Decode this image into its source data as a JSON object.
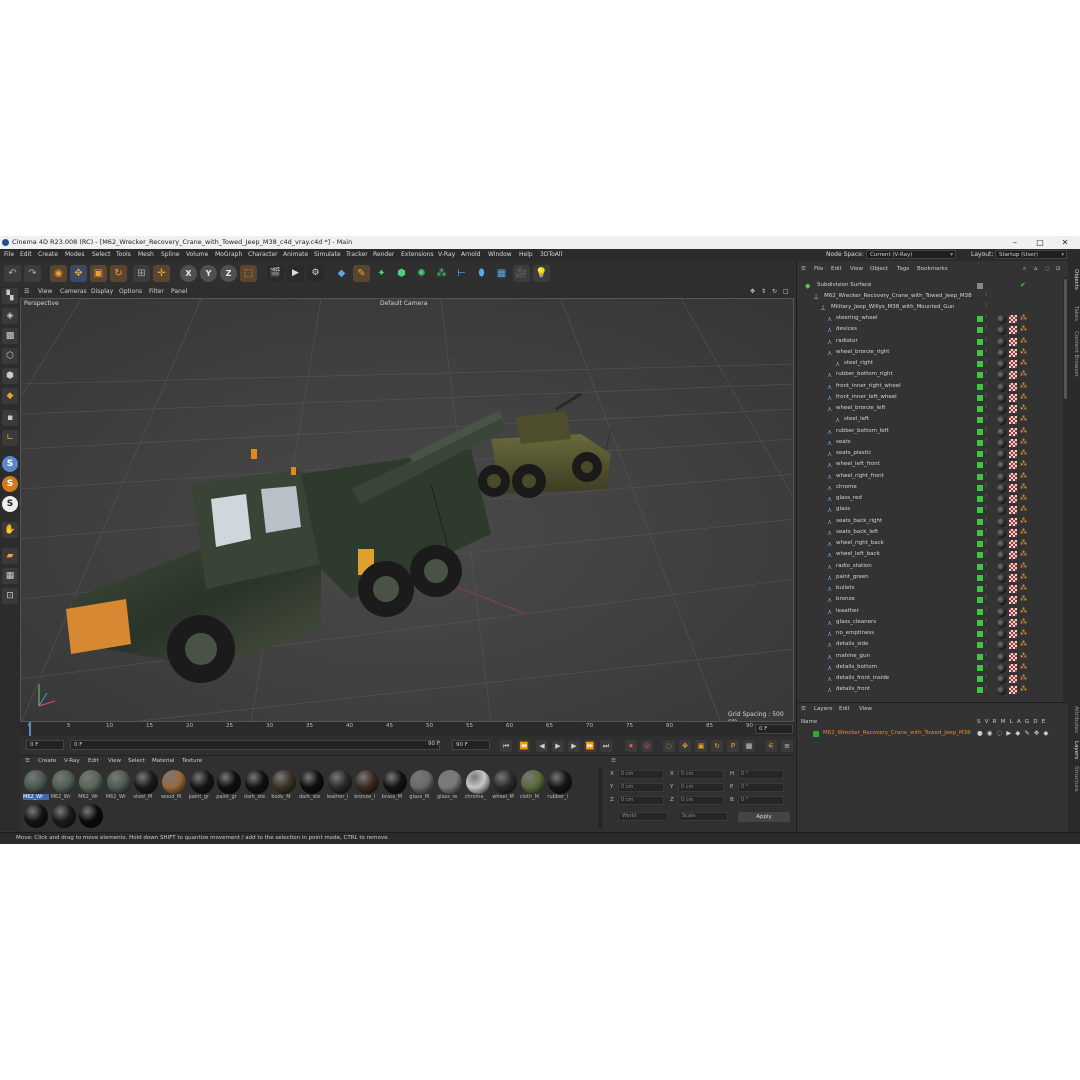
{
  "window": {
    "title": "Cinema 4D R23.008 (RC) - [M62_Wrecker_Recovery_Crane_with_Towed_Jeep_M38_c4d_vray.c4d *] - Main",
    "minimize": "–",
    "maximize": "□",
    "close": "✕"
  },
  "menubar": {
    "items": [
      "File",
      "Edit",
      "Create",
      "Modes",
      "Select",
      "Tools",
      "Mesh",
      "Spline",
      "Volume",
      "MoGraph",
      "Character",
      "Animate",
      "Simulate",
      "Tracker",
      "Render",
      "Extensions",
      "V-Ray",
      "Arnold",
      "Window",
      "Help",
      "3DToAll"
    ],
    "node_space_label": "Node Space:",
    "node_space_value": "Current (V-Ray)",
    "layout_label": "Layout:",
    "layout_value": "Startup (User)"
  },
  "viewport": {
    "menu": [
      "View",
      "Cameras",
      "Display",
      "Options",
      "Filter",
      "Panel"
    ],
    "name": "Perspective",
    "camera": "Default Camera",
    "grid_spacing": "Grid Spacing : 500 cm"
  },
  "timeline": {
    "ticks": [
      "0",
      "5",
      "10",
      "15",
      "20",
      "25",
      "30",
      "35",
      "40",
      "45",
      "50",
      "55",
      "60",
      "65",
      "70",
      "75",
      "80",
      "85",
      "90"
    ],
    "current_frame": "0 F",
    "start_frame": "0 F",
    "preview_start": "0 F",
    "preview_end": "90 F",
    "end_frame": "90 F",
    "frame_display": "0 F"
  },
  "material_manager": {
    "menu": [
      "Create",
      "V-Ray",
      "Edit",
      "View",
      "Select",
      "Material",
      "Texture"
    ],
    "materials": [
      {
        "name": "M62_Wr",
        "color": "#4a5a4f"
      },
      {
        "name": "M62_Wr",
        "color": "#505e52"
      },
      {
        "name": "M62_Wr",
        "color": "#59665a"
      },
      {
        "name": "M62_Wr",
        "color": "#4d5b50"
      },
      {
        "name": "steel_M",
        "color": "#1a1a1a"
      },
      {
        "name": "wood_M",
        "color": "#9a6a3a"
      },
      {
        "name": "paint_gr",
        "color": "#151515"
      },
      {
        "name": "paint_gr",
        "color": "#0e0e0e"
      },
      {
        "name": "dark_ste",
        "color": "#111111"
      },
      {
        "name": "body_M",
        "color": "#3a3424"
      },
      {
        "name": "dark_ste",
        "color": "#0d0d0d"
      },
      {
        "name": "leather_l",
        "color": "#2a2a2a"
      },
      {
        "name": "bronze_l",
        "color": "#3a2a20"
      },
      {
        "name": "brass_M",
        "color": "#121212"
      },
      {
        "name": "glass_M",
        "color": "#6a6a6a"
      },
      {
        "name": "glass_re",
        "color": "#7a7a7a"
      },
      {
        "name": "chrome_",
        "color": "#c8c8c8"
      },
      {
        "name": "wheel_M",
        "color": "#2a2a2a"
      },
      {
        "name": "cloth_M",
        "color": "#5a6a3a"
      },
      {
        "name": "rubber_l",
        "color": "#151515"
      },
      {
        "name": "",
        "color": "#121212"
      },
      {
        "name": "",
        "color": "#1a1a1a"
      },
      {
        "name": "",
        "color": "#0a0a0a"
      }
    ]
  },
  "coordinates": {
    "rows": [
      {
        "a": "X",
        "av": "0 cm",
        "b": "X",
        "bv": "0 cm",
        "c": "H",
        "cv": "0 °"
      },
      {
        "a": "Y",
        "av": "0 cm",
        "b": "Y",
        "bv": "0 cm",
        "c": "P",
        "cv": "0 °"
      },
      {
        "a": "Z",
        "av": "0 cm",
        "b": "Z",
        "bv": "0 cm",
        "c": "B",
        "cv": "0 °"
      }
    ],
    "mode": "World",
    "mode2": "Scale",
    "apply": "Apply"
  },
  "status": "Move: Click and drag to move elements. Hold down SHIFT to quantize movement / add to the selection in point mode, CTRL to remove.",
  "object_manager": {
    "menu": [
      "File",
      "Edit",
      "View",
      "Object",
      "Tags",
      "Bookmarks"
    ],
    "root": "Subdivision Surface",
    "group": "M62_Wrecker_Recovery_Crane_with_Towed_Jeep_M38",
    "subgroup": "Military_Jeep_Willys_M38_with_Mounted_Gun",
    "objects": [
      {
        "name": "steering_wheel",
        "indent": 0
      },
      {
        "name": "devices",
        "indent": 0
      },
      {
        "name": "radiator",
        "indent": 0
      },
      {
        "name": "wheel_bronze_right",
        "indent": 0
      },
      {
        "name": "steel_right",
        "indent": 1
      },
      {
        "name": "rubber_bottom_right",
        "indent": 0
      },
      {
        "name": "front_inner_right_wheel",
        "indent": 0
      },
      {
        "name": "front_inner_left_wheel",
        "indent": 0
      },
      {
        "name": "wheel_bronze_left",
        "indent": 0
      },
      {
        "name": "steel_left",
        "indent": 1
      },
      {
        "name": "rubber_bottom_left",
        "indent": 0
      },
      {
        "name": "seats",
        "indent": 0
      },
      {
        "name": "seats_plastic",
        "indent": 0
      },
      {
        "name": "wheel_left_front",
        "indent": 0
      },
      {
        "name": "wheel_right_front",
        "indent": 0
      },
      {
        "name": "chrome",
        "indent": 0
      },
      {
        "name": "glass_red",
        "indent": 0
      },
      {
        "name": "glass",
        "indent": 0
      },
      {
        "name": "seats_back_right",
        "indent": 0
      },
      {
        "name": "seats_back_left",
        "indent": 0
      },
      {
        "name": "wheel_right_back",
        "indent": 0
      },
      {
        "name": "wheel_left_back",
        "indent": 0
      },
      {
        "name": "radio_station",
        "indent": 0
      },
      {
        "name": "paint_green",
        "indent": 0
      },
      {
        "name": "bullets",
        "indent": 0
      },
      {
        "name": "bronze",
        "indent": 0
      },
      {
        "name": "leaather",
        "indent": 0
      },
      {
        "name": "glass_cleaners",
        "indent": 0
      },
      {
        "name": "no_emptiness",
        "indent": 0
      },
      {
        "name": "details_side",
        "indent": 0
      },
      {
        "name": "mahine_gun",
        "indent": 0
      },
      {
        "name": "details_bottom",
        "indent": 0
      },
      {
        "name": "details_front_inside",
        "indent": 0
      },
      {
        "name": "details_front",
        "indent": 0
      }
    ]
  },
  "layers": {
    "menu": [
      "Layers",
      "Edit",
      "View"
    ],
    "header_name": "Name",
    "header_cols": [
      "S",
      "V",
      "R",
      "M",
      "L",
      "A",
      "G",
      "D",
      "E"
    ],
    "layer_name": "M62_Wrecker_Recovery_Crane_with_Towed_Jeep_M38",
    "layer_color": "#2ea82e"
  },
  "side_tabs": [
    "Objects",
    "Takes",
    "Content Browser",
    "Attributes",
    "Layers",
    "Structure"
  ]
}
